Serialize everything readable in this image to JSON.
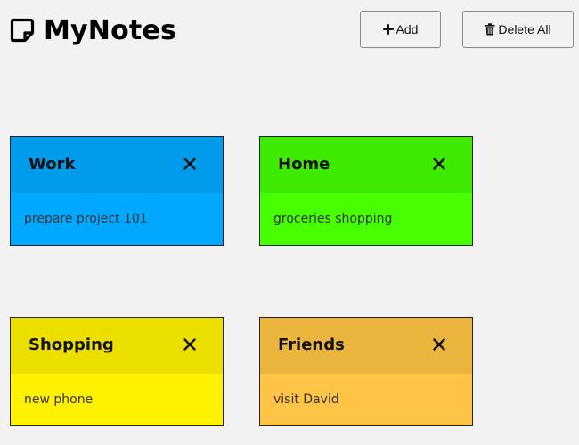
{
  "app": {
    "title": "MyNotes",
    "icon": "sticky-note-icon"
  },
  "toolbar": {
    "add_label": "Add",
    "add_icon": "plus-icon",
    "delete_all_label": "Delete All",
    "delete_all_icon": "trash-icon"
  },
  "notes": [
    {
      "title": "Work",
      "body": "prepare project 101",
      "header_color": "#009CEB",
      "body_color": "#00A9FF"
    },
    {
      "title": "Home",
      "body": "groceries shopping",
      "header_color": "#3EEA00",
      "body_color": "#47FF00"
    },
    {
      "title": "Shopping",
      "body": "new phone",
      "header_color": "#EBDF00",
      "body_color": "#FFF200"
    },
    {
      "title": "Friends",
      "body": "visit David",
      "header_color": "#EBB53D",
      "body_color": "#FFC445"
    }
  ],
  "note_close_icon": "close-icon"
}
